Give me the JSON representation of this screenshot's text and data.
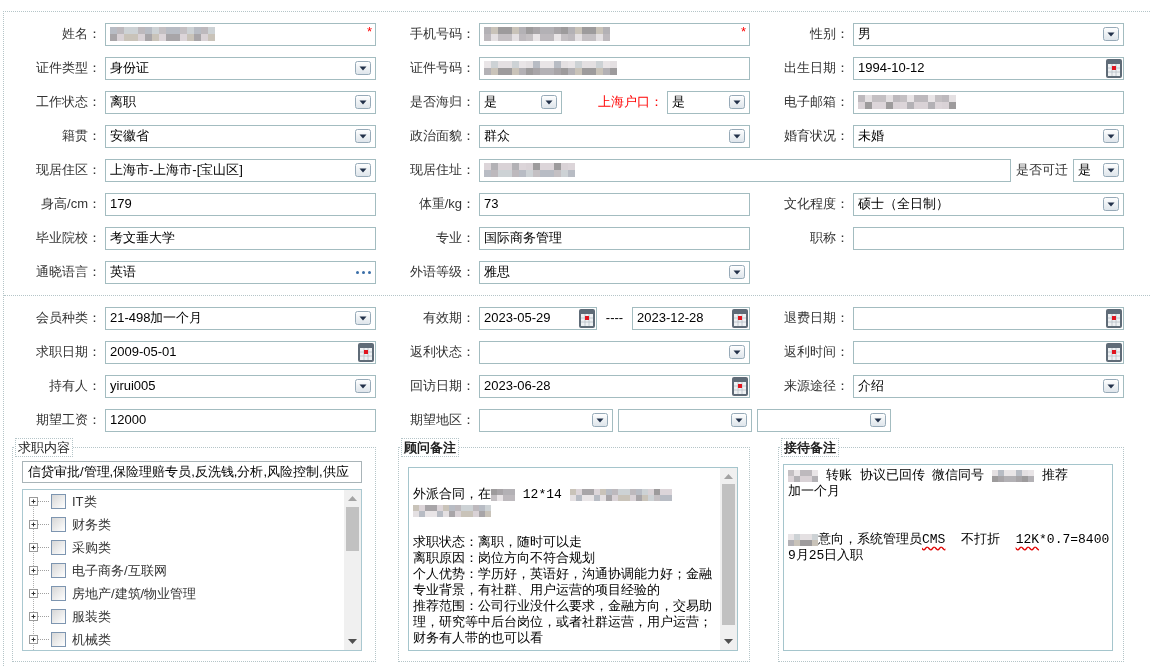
{
  "sections": [
    {
      "rows": [
        {
          "cells": [
            {
              "kind": "single",
              "label": "姓名：",
              "controls": [
                {
                  "kind": "text",
                  "redacted": true,
                  "required_mark": "*"
                }
              ]
            },
            {
              "kind": "single",
              "label": "手机号码：",
              "controls": [
                {
                  "kind": "text",
                  "redacted": true,
                  "required_mark": "*"
                }
              ]
            },
            {
              "kind": "single",
              "label": "性别：",
              "controls": [
                {
                  "kind": "select",
                  "value": "男"
                }
              ]
            }
          ]
        },
        {
          "cells": [
            {
              "kind": "single",
              "label": "证件类型：",
              "controls": [
                {
                  "kind": "select",
                  "value": "身份证"
                }
              ]
            },
            {
              "kind": "single",
              "label": "证件号码：",
              "controls": [
                {
                  "kind": "text",
                  "redacted": true
                }
              ]
            },
            {
              "kind": "single",
              "label": "出生日期：",
              "controls": [
                {
                  "kind": "date",
                  "value": "1994-10-12"
                }
              ]
            }
          ]
        },
        {
          "cells": [
            {
              "kind": "single",
              "label": "工作状态：",
              "controls": [
                {
                  "kind": "select",
                  "value": "离职"
                }
              ]
            },
            {
              "kind": "pair",
              "label": "是否海归：",
              "controls": [
                {
                  "kind": "select",
                  "value": "是"
                },
                {
                  "kind": "label",
                  "text": "上海户口：",
                  "highlighted": true
                },
                {
                  "kind": "select",
                  "value": "是"
                }
              ]
            },
            {
              "kind": "single",
              "label": "电子邮箱：",
              "controls": [
                {
                  "kind": "text",
                  "redacted": true
                }
              ]
            }
          ]
        },
        {
          "cells": [
            {
              "kind": "single",
              "label": "籍贯：",
              "controls": [
                {
                  "kind": "select",
                  "value": "安徽省"
                }
              ]
            },
            {
              "kind": "single",
              "label": "政治面貌：",
              "controls": [
                {
                  "kind": "select",
                  "value": "群众"
                }
              ]
            },
            {
              "kind": "single",
              "label": "婚育状况：",
              "controls": [
                {
                  "kind": "select",
                  "value": "未婚"
                }
              ]
            }
          ]
        },
        {
          "cells": [
            {
              "kind": "single",
              "label": "现居住区：",
              "controls": [
                {
                  "kind": "select",
                  "value": "上海市-上海市-[宝山区]"
                }
              ]
            },
            {
              "kind": "wide",
              "label": "现居住址：",
              "controls": [
                {
                  "kind": "text",
                  "redacted": true
                },
                {
                  "kind": "label",
                  "text": "是否可迁",
                  "highlighted": false
                },
                {
                  "kind": "select",
                  "value": "是"
                }
              ]
            }
          ]
        },
        {
          "cells": [
            {
              "kind": "single",
              "label": "身高/cm：",
              "controls": [
                {
                  "kind": "text",
                  "redacted": false,
                  "value": "179"
                }
              ]
            },
            {
              "kind": "single",
              "label": "体重/kg：",
              "controls": [
                {
                  "kind": "text",
                  "redacted": false,
                  "value": "73"
                }
              ]
            },
            {
              "kind": "single",
              "label": "文化程度：",
              "controls": [
                {
                  "kind": "select",
                  "value": "硕士（全日制）"
                }
              ]
            }
          ]
        },
        {
          "cells": [
            {
              "kind": "single",
              "label": "毕业院校：",
              "controls": [
                {
                  "kind": "text",
                  "redacted": false,
                  "value": "考文垂大学"
                }
              ]
            },
            {
              "kind": "single",
              "label": "专业：",
              "controls": [
                {
                  "kind": "text",
                  "redacted": false,
                  "value": "国际商务管理"
                }
              ]
            },
            {
              "kind": "single",
              "label": "职称：",
              "controls": [
                {
                  "kind": "text",
                  "redacted": false
                }
              ]
            }
          ]
        },
        {
          "cells": [
            {
              "kind": "single",
              "label": "通晓语言：",
              "controls": [
                {
                  "kind": "picker",
                  "value": "英语"
                }
              ]
            },
            {
              "kind": "single",
              "label": "外语等级：",
              "controls": [
                {
                  "kind": "select",
                  "value": "雅思"
                }
              ]
            }
          ]
        }
      ]
    },
    {
      "rows": [
        {
          "cells": [
            {
              "kind": "single",
              "label": "会员种类：",
              "controls": [
                {
                  "kind": "select",
                  "value": "21-498加一个月"
                }
              ]
            },
            {
              "kind": "range",
              "label": "有效期：",
              "controls": [
                {
                  "kind": "date",
                  "value": "2023-05-29"
                },
                {
                  "kind": "separator",
                  "text": "----"
                },
                {
                  "kind": "date",
                  "value": "2023-12-28"
                }
              ]
            },
            {
              "kind": "single",
              "label": "退费日期：",
              "controls": [
                {
                  "kind": "date"
                }
              ]
            }
          ]
        },
        {
          "cells": [
            {
              "kind": "single",
              "label": "求职日期：",
              "controls": [
                {
                  "kind": "date",
                  "value": "2009-05-01"
                }
              ]
            },
            {
              "kind": "single",
              "label": "返利状态：",
              "controls": [
                {
                  "kind": "select"
                }
              ]
            },
            {
              "kind": "single",
              "label": "返利时间：",
              "controls": [
                {
                  "kind": "date"
                }
              ]
            }
          ]
        },
        {
          "cells": [
            {
              "kind": "single",
              "label": "持有人：",
              "controls": [
                {
                  "kind": "select",
                  "value": "yirui005"
                }
              ]
            },
            {
              "kind": "single",
              "label": "回访日期：",
              "controls": [
                {
                  "kind": "date",
                  "value": "2023-06-28"
                }
              ]
            },
            {
              "kind": "single",
              "label": "来源途径：",
              "controls": [
                {
                  "kind": "select",
                  "value": "介绍"
                }
              ]
            }
          ]
        },
        {
          "cells": [
            {
              "kind": "single",
              "label": "期望工资：",
              "controls": [
                {
                  "kind": "text",
                  "redacted": false,
                  "value": "12000"
                }
              ]
            },
            {
              "kind": "triple",
              "label": "期望地区：",
              "controls": [
                {
                  "kind": "select"
                },
                {
                  "kind": "select"
                },
                {
                  "kind": "select"
                }
              ]
            }
          ]
        }
      ]
    }
  ],
  "panels": [
    {
      "kind": "tree",
      "title": "求职内容",
      "title_bold": false,
      "summary_field": {
        "value": "信贷审批/管理,保险理赔专员,反洗钱,分析,风险控制,供应"
      },
      "scrollbar": true,
      "items": [
        {
          "label": "IT类",
          "expanded": false,
          "checked": false
        },
        {
          "label": "财务类",
          "expanded": false,
          "checked": false
        },
        {
          "label": "采购类",
          "expanded": false,
          "checked": false
        },
        {
          "label": "电子商务/互联网",
          "expanded": false,
          "checked": false
        },
        {
          "label": "房地产/建筑/物业管理",
          "expanded": false,
          "checked": false
        },
        {
          "label": "服装类",
          "expanded": false,
          "checked": false
        },
        {
          "label": "机械类",
          "expanded": false,
          "checked": false
        }
      ]
    },
    {
      "kind": "notes",
      "title": "顾问备注",
      "title_bold": true,
      "scrollbar": true,
      "paragraphs": [
        {
          "kind": "blank"
        },
        {
          "kind": "line",
          "segments": [
            {
              "kind": "text",
              "text": "外派合同，在"
            },
            {
              "kind": "redacted"
            },
            {
              "kind": "text",
              "text": " 12*14 "
            },
            {
              "kind": "redacted"
            },
            {
              "kind": "redacted"
            },
            {
              "kind": "redacted"
            }
          ]
        },
        {
          "kind": "line",
          "segments": [
            {
              "kind": "redacted"
            },
            {
              "kind": "redacted"
            }
          ]
        },
        {
          "kind": "blank"
        },
        {
          "kind": "line",
          "segments": [
            {
              "kind": "text",
              "text": "求职状态：离职，随时可以走"
            }
          ]
        },
        {
          "kind": "line",
          "segments": [
            {
              "kind": "text",
              "text": "离职原因：岗位方向不符合规划"
            }
          ]
        },
        {
          "kind": "line",
          "segments": [
            {
              "kind": "text",
              "text": "个人优势：学历好，英语好，沟通协调能力好；金融专业背景，有社群、用户运营的项目经验的"
            }
          ]
        },
        {
          "kind": "line",
          "segments": [
            {
              "kind": "text",
              "text": "推荐范围：公司行业没什么要求，金融方向，交易助理，研究等中后台岗位，或者社群运营，用户运营；财务有人带的也可以看"
            }
          ]
        }
      ]
    },
    {
      "kind": "notes",
      "title": "接待备注",
      "title_bold": true,
      "scrollbar": false,
      "paragraphs": [
        {
          "kind": "line",
          "segments": [
            {
              "kind": "redacted"
            },
            {
              "kind": "text",
              "text": " 转账 协议已回传 微信同号 "
            },
            {
              "kind": "redacted"
            },
            {
              "kind": "text",
              "text": " 推荐"
            }
          ]
        },
        {
          "kind": "line",
          "segments": [
            {
              "kind": "text",
              "text": "加一个月"
            }
          ]
        },
        {
          "kind": "blank"
        },
        {
          "kind": "blank"
        },
        {
          "kind": "line",
          "segments": [
            {
              "kind": "redacted"
            },
            {
              "kind": "text",
              "text": "意向，系统管理员"
            },
            {
              "kind": "flagged",
              "text": "CMS"
            },
            {
              "kind": "text",
              "text": "  不打折  "
            },
            {
              "kind": "flagged",
              "text": "12K"
            },
            {
              "kind": "text",
              "text": "*0.7=8400"
            }
          ]
        },
        {
          "kind": "line",
          "segments": [
            {
              "kind": "text",
              "text": "9月25日入职"
            }
          ]
        }
      ]
    }
  ]
}
